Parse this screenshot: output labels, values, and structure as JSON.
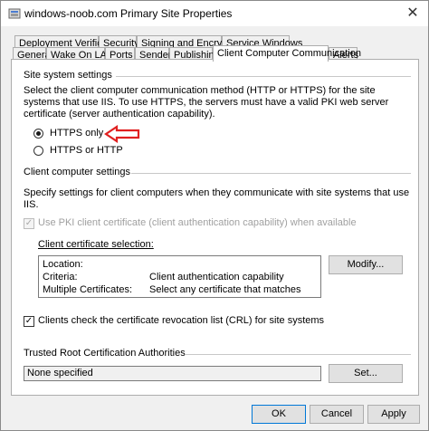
{
  "window": {
    "title": "windows-noob.com Primary Site Properties",
    "close_glyph": "✕"
  },
  "tabs_back": [
    {
      "label": "Deployment Verification"
    },
    {
      "label": "Security"
    },
    {
      "label": "Signing and Encryption"
    },
    {
      "label": "Service Windows"
    }
  ],
  "tabs_front": [
    {
      "label": "General"
    },
    {
      "label": "Wake On LAN"
    },
    {
      "label": "Ports"
    },
    {
      "label": "Sender"
    },
    {
      "label": "Publishing"
    },
    {
      "label": "Client Computer Communication"
    },
    {
      "label": "Alerts"
    }
  ],
  "site_system": {
    "heading": "Site system settings",
    "description": "Select the client computer communication method (HTTP or HTTPS) for the site systems that use IIS. To use HTTPS, the servers must have a valid PKI web server certificate (server authentication capability).",
    "radio_https_only": {
      "label": "HTTPS only",
      "checked": true
    },
    "radio_https_or_http": {
      "label": "HTTPS or HTTP",
      "checked": false
    }
  },
  "annotation": {
    "arrow_color": "#e02020"
  },
  "client_computer": {
    "heading": "Client computer settings",
    "description": "Specify settings for client computers when they communicate with site systems that use IIS.",
    "use_pki_checkbox": {
      "label": "Use PKI client certificate (client authentication capability) when available",
      "checked": true,
      "enabled": false
    },
    "cert_selection_label": "Client certificate selection:",
    "cert_rows": [
      {
        "key": "Location:",
        "value": ""
      },
      {
        "key": "Criteria:",
        "value": "Client authentication capability"
      },
      {
        "key": "Multiple Certificates:",
        "value": "Select any certificate that matches"
      }
    ],
    "modify_button": "Modify...",
    "crl_checkbox": {
      "label": "Clients check the certificate revocation list (CRL) for site systems",
      "checked": true
    }
  },
  "trusted_root": {
    "heading": "Trusted Root Certification Authorities",
    "value": "None specified",
    "set_button": "Set..."
  },
  "footer": {
    "ok": "OK",
    "cancel": "Cancel",
    "apply": "Apply"
  }
}
